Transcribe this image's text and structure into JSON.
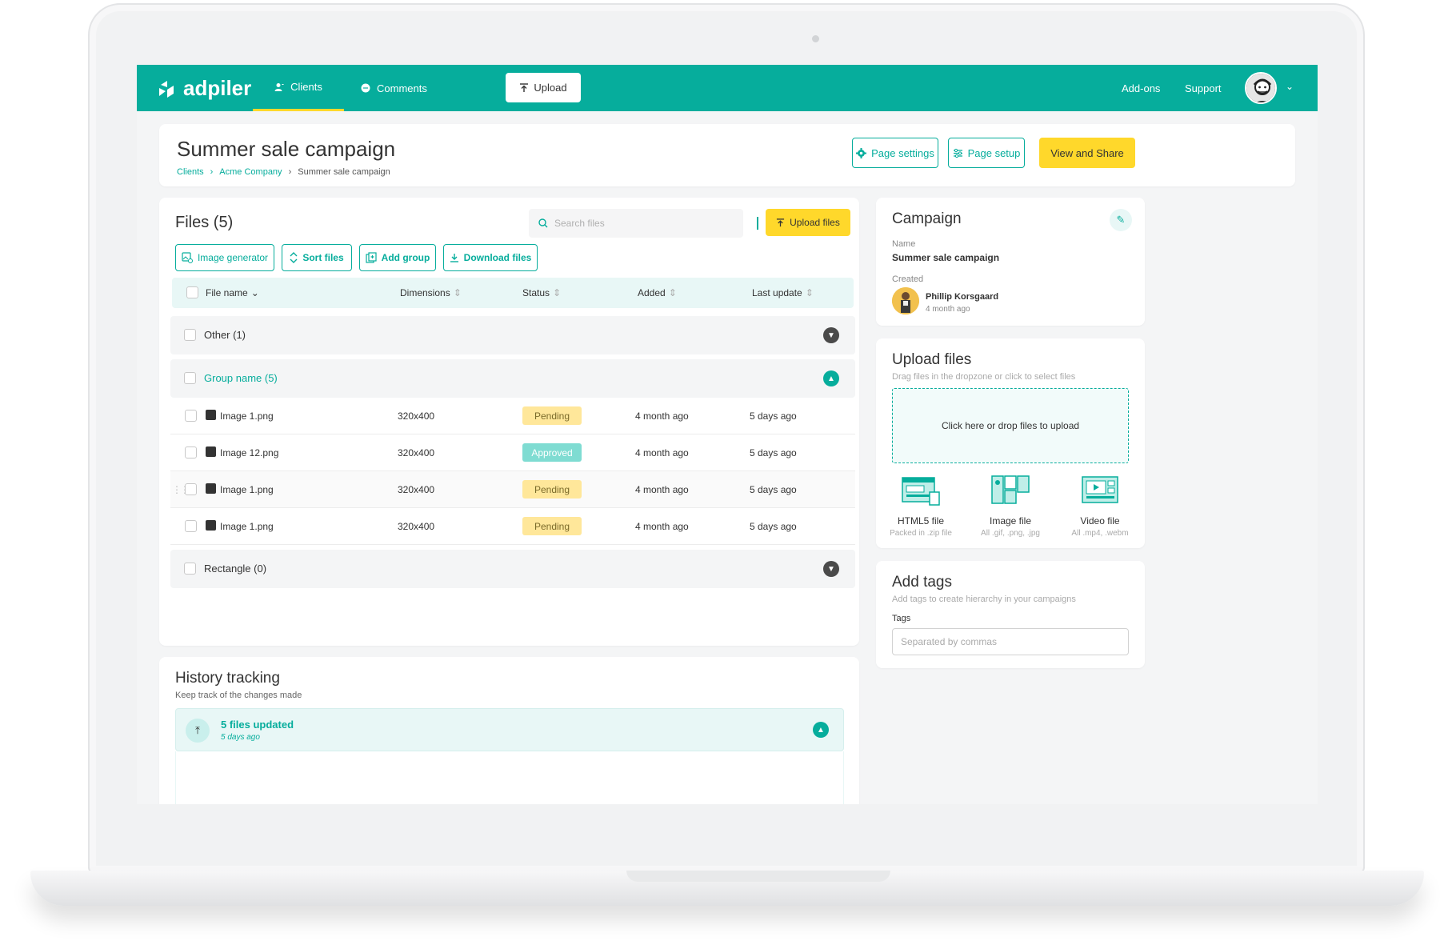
{
  "nav": {
    "logo": "adpiler",
    "clients": "Clients",
    "comments": "Comments",
    "upload": "Upload",
    "addons": "Add-ons",
    "support": "Support"
  },
  "header": {
    "title": "Summer sale campaign",
    "breadcrumb": [
      "Clients",
      "Acme Company",
      "Summer sale campaign"
    ],
    "page_settings": "Page settings",
    "page_setup": "Page setup",
    "view_share": "View and Share"
  },
  "files": {
    "title": "Files (5)",
    "search_placeholder": "Search files",
    "upload_files": "Upload files",
    "tools": [
      "Image generator",
      "Sort files",
      "Add group",
      "Download files"
    ],
    "columns": [
      "File name",
      "Dimensions",
      "Status",
      "Added",
      "Last update"
    ],
    "groups": [
      {
        "label": "Other (1)"
      },
      {
        "label": "Group name (5)"
      },
      {
        "label": "Rectangle (0)"
      }
    ],
    "rows": [
      {
        "name": "Image 1.png",
        "dimensions": "320x400",
        "status": "Pending",
        "added": "4 month ago",
        "updated": "5 days ago"
      },
      {
        "name": "Image 12.png",
        "dimensions": "320x400",
        "status": "Approved",
        "added": "4 month ago",
        "updated": "5 days ago"
      },
      {
        "name": "Image 1.png",
        "dimensions": "320x400",
        "status": "Pending",
        "added": "4 month ago",
        "updated": "5 days ago"
      },
      {
        "name": "Image 1.png",
        "dimensions": "320x400",
        "status": "Pending",
        "added": "4 month ago",
        "updated": "5 days ago"
      }
    ]
  },
  "history": {
    "title": "History tracking",
    "subtitle": "Keep track of the changes made",
    "event_title": "5 files updated",
    "event_time": "5 days ago"
  },
  "campaign": {
    "title": "Campaign",
    "name_label": "Name",
    "name_value": "Summer sale campaign",
    "created_label": "Created",
    "creator": "Phillip Korsgaard",
    "created_time": "4 month ago"
  },
  "upload": {
    "title": "Upload files",
    "subtitle": "Drag files in the dropzone or click to select files",
    "dropzone": "Click here or drop files to upload",
    "types": [
      {
        "title": "HTML5 file",
        "sub": "Packed in .zip file"
      },
      {
        "title": "Image file",
        "sub": "All .gif, .png, .jpg"
      },
      {
        "title": "Video file",
        "sub": "All .mp4, .webm"
      }
    ]
  },
  "tags": {
    "title": "Add tags",
    "subtitle": "Add tags to create hierarchy in your campaigns",
    "label": "Tags",
    "placeholder": "Separated by  commas"
  },
  "colors": {
    "brand": "#06ad9c",
    "accent": "#ffd82b",
    "pending": "#ffe79a",
    "approved": "#7fdcd2"
  }
}
